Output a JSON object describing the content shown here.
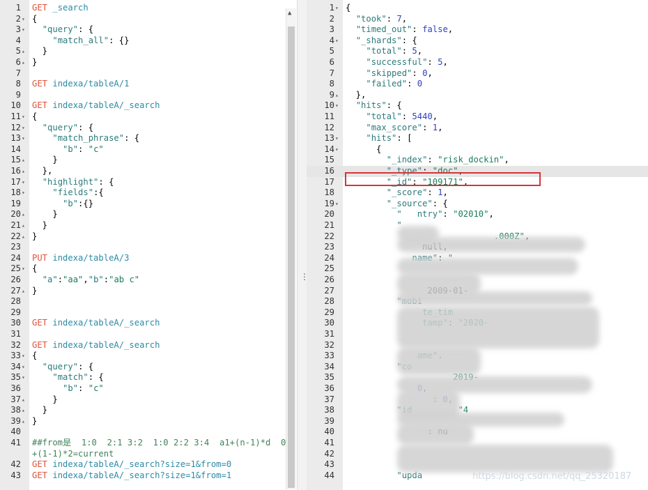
{
  "left_editor": {
    "lines": [
      {
        "n": "1",
        "fold": "",
        "html": "<span class='kw'>GET</span> <span class='url'>_search</span>"
      },
      {
        "n": "2",
        "fold": "▾",
        "html": "{"
      },
      {
        "n": "3",
        "fold": "▾",
        "html": "  <span class='k'>\"query\"</span>: {"
      },
      {
        "n": "4",
        "fold": "",
        "html": "    <span class='k'>\"match_all\"</span>: {}"
      },
      {
        "n": "5",
        "fold": "▴",
        "html": "  }"
      },
      {
        "n": "6",
        "fold": "▴",
        "html": "}"
      },
      {
        "n": "7",
        "fold": "",
        "html": ""
      },
      {
        "n": "8",
        "fold": "",
        "html": "<span class='kw'>GET</span> <span class='url'>indexa/tableA/1</span>"
      },
      {
        "n": "9",
        "fold": "",
        "html": ""
      },
      {
        "n": "10",
        "fold": "",
        "html": "<span class='kw'>GET</span> <span class='url'>indexa/tableA/_search</span>"
      },
      {
        "n": "11",
        "fold": "▾",
        "html": "{"
      },
      {
        "n": "12",
        "fold": "▾",
        "html": "  <span class='k'>\"query\"</span>: {"
      },
      {
        "n": "13",
        "fold": "▾",
        "html": "    <span class='k'>\"match_phrase\"</span>: {"
      },
      {
        "n": "14",
        "fold": "",
        "html": "      <span class='k'>\"b\"</span>: <span class='str'>\"c\"</span>"
      },
      {
        "n": "15",
        "fold": "▴",
        "html": "    }"
      },
      {
        "n": "16",
        "fold": "▴",
        "html": "  },"
      },
      {
        "n": "17",
        "fold": "▾",
        "html": "  <span class='k'>\"highlight\"</span>: {"
      },
      {
        "n": "18",
        "fold": "▾",
        "html": "    <span class='k'>\"fields\"</span>:{"
      },
      {
        "n": "19",
        "fold": "",
        "html": "      <span class='k'>\"b\"</span>:{}"
      },
      {
        "n": "20",
        "fold": "▴",
        "html": "    }"
      },
      {
        "n": "21",
        "fold": "▴",
        "html": "  }"
      },
      {
        "n": "22",
        "fold": "▴",
        "html": "}"
      },
      {
        "n": "23",
        "fold": "",
        "html": ""
      },
      {
        "n": "24",
        "fold": "",
        "html": "<span class='kw'>PUT</span> <span class='url'>indexa/tableA/3</span>"
      },
      {
        "n": "25",
        "fold": "▾",
        "html": "{"
      },
      {
        "n": "26",
        "fold": "",
        "html": "  <span class='k'>\"a\"</span>:<span class='str'>\"aa\"</span>,<span class='k'>\"b\"</span>:<span class='str'>\"ab c\"</span>"
      },
      {
        "n": "27",
        "fold": "▴",
        "html": "}"
      },
      {
        "n": "28",
        "fold": "",
        "html": ""
      },
      {
        "n": "29",
        "fold": "",
        "html": ""
      },
      {
        "n": "30",
        "fold": "",
        "html": "<span class='kw'>GET</span> <span class='url'>indexa/tableA/_search</span>"
      },
      {
        "n": "31",
        "fold": "",
        "html": ""
      },
      {
        "n": "32",
        "fold": "",
        "html": "<span class='kw'>GET</span> <span class='url'>indexa/tableA/_search</span>"
      },
      {
        "n": "33",
        "fold": "▾",
        "html": "{"
      },
      {
        "n": "34",
        "fold": "▾",
        "html": "  <span class='k'>\"query\"</span>: {"
      },
      {
        "n": "35",
        "fold": "▾",
        "html": "    <span class='k'>\"match\"</span>: {"
      },
      {
        "n": "36",
        "fold": "",
        "html": "      <span class='k'>\"b\"</span>: <span class='str'>\"c\"</span>"
      },
      {
        "n": "37",
        "fold": "▴",
        "html": "    }"
      },
      {
        "n": "38",
        "fold": "▴",
        "html": "  }"
      },
      {
        "n": "39",
        "fold": "▴",
        "html": "}"
      },
      {
        "n": "40",
        "fold": "",
        "html": ""
      },
      {
        "n": "41",
        "fold": "",
        "html": "<span class='cmt'>##from是  1:0  2:1 3:2  1:0 2:2 3:4  a1+(n-1)*d  0</span>"
      },
      {
        "n": "",
        "fold": "",
        "html": "<span class='cmt'>+(1-1)*2=current</span>"
      },
      {
        "n": "42",
        "fold": "",
        "html": "<span class='kw'>GET</span> <span class='url'>indexa/tableA/_search?size=1&amp;from=0</span>"
      },
      {
        "n": "43",
        "fold": "",
        "html": "<span class='kw'>GET</span> <span class='url'>indexa/tableA/_search?size=1&amp;from=1</span>"
      }
    ]
  },
  "right_editor": {
    "highlighted_line": "16",
    "lines": [
      {
        "n": "1",
        "fold": "▾",
        "html": "{"
      },
      {
        "n": "2",
        "fold": "",
        "html": "  <span class='k'>\"took\"</span>: <span class='num'>7</span>,"
      },
      {
        "n": "3",
        "fold": "",
        "html": "  <span class='k'>\"timed_out\"</span>: <span class='bool'>false</span>,"
      },
      {
        "n": "4",
        "fold": "▾",
        "html": "  <span class='k'>\"_shards\"</span>: {"
      },
      {
        "n": "5",
        "fold": "",
        "html": "    <span class='k'>\"total\"</span>: <span class='num'>5</span>,"
      },
      {
        "n": "6",
        "fold": "",
        "html": "    <span class='k'>\"successful\"</span>: <span class='num'>5</span>,"
      },
      {
        "n": "7",
        "fold": "",
        "html": "    <span class='k'>\"skipped\"</span>: <span class='num'>0</span>,"
      },
      {
        "n": "8",
        "fold": "",
        "html": "    <span class='k'>\"failed\"</span>: <span class='num'>0</span>"
      },
      {
        "n": "9",
        "fold": "▴",
        "html": "  },"
      },
      {
        "n": "10",
        "fold": "▾",
        "html": "  <span class='k'>\"hits\"</span>: {"
      },
      {
        "n": "11",
        "fold": "",
        "html": "    <span class='k'>\"total\"</span>: <span class='num'>5440</span>,"
      },
      {
        "n": "12",
        "fold": "",
        "html": "    <span class='k'>\"max_score\"</span>: <span class='num'>1</span>,"
      },
      {
        "n": "13",
        "fold": "▾",
        "html": "    <span class='k'>\"hits\"</span>: ["
      },
      {
        "n": "14",
        "fold": "▾",
        "html": "      {"
      },
      {
        "n": "15",
        "fold": "",
        "html": "        <span class='k'>\"_index\"</span>: <span class='str'>\"risk_dockin\"</span>,"
      },
      {
        "n": "16",
        "fold": "",
        "html": "        <span class='k'>\"_type\"</span>: <span class='str'>\"doc\"</span>,"
      },
      {
        "n": "17",
        "fold": "",
        "html": "        <span class='k'>\"_id\"</span>: <span class='str'>\"109171\"</span>,"
      },
      {
        "n": "18",
        "fold": "",
        "html": "        <span class='k'>\"_score\"</span>: <span class='num'>1</span>,"
      },
      {
        "n": "19",
        "fold": "▾",
        "html": "        <span class='k'>\"_source\"</span>: {"
      },
      {
        "n": "20",
        "fold": "",
        "html": "          <span class='k'>\"   ntry\"</span>: <span class='str'>\"02010\"</span>,"
      },
      {
        "n": "21",
        "fold": "",
        "html": "          <span class='k'>\"</span>"
      },
      {
        "n": "22",
        "fold": "",
        "html": "                             <span class='str'>.000Z\"</span>,"
      },
      {
        "n": "23",
        "fold": "",
        "html": "               null,"
      },
      {
        "n": "24",
        "fold": "",
        "html": "             <span class='k'>name\"</span>: <span class='str'>\"</span>"
      },
      {
        "n": "25",
        "fold": "",
        "html": ""
      },
      {
        "n": "26",
        "fold": "",
        "html": ""
      },
      {
        "n": "27",
        "fold": "",
        "html": "                2009-01-"
      },
      {
        "n": "28",
        "fold": "",
        "html": "          <span class='k'>\"mobi</span>"
      },
      {
        "n": "29",
        "fold": "",
        "html": "               <span class='k'>te_tim</span>"
      },
      {
        "n": "30",
        "fold": "",
        "html": "               <span class='k'>tamp\"</span>: <span class='str'>\"2020-</span>"
      },
      {
        "n": "31",
        "fold": "",
        "html": ""
      },
      {
        "n": "32",
        "fold": "",
        "html": ""
      },
      {
        "n": "33",
        "fold": "",
        "html": "              <span class='k'>ame\"</span>."
      },
      {
        "n": "34",
        "fold": "",
        "html": "          <span class='k'>\"co</span>"
      },
      {
        "n": "35",
        "fold": "",
        "html": "                     <span class='str'>2019-</span>"
      },
      {
        "n": "36",
        "fold": "",
        "html": "              <span class='num'>0</span>,"
      },
      {
        "n": "37",
        "fold": "",
        "html": "                 : <span class='num'>0</span>,"
      },
      {
        "n": "38",
        "fold": "",
        "html": "          <span class='k'>\"id</span>         <span class='str'>\"4</span>"
      },
      {
        "n": "39",
        "fold": "",
        "html": ""
      },
      {
        "n": "40",
        "fold": "",
        "html": "                : nu"
      },
      {
        "n": "41",
        "fold": "",
        "html": ""
      },
      {
        "n": "42",
        "fold": "",
        "html": ""
      },
      {
        "n": "43",
        "fold": "",
        "html": ""
      },
      {
        "n": "44",
        "fold": "",
        "html": "          <span class='k'>\"upda</span>"
      }
    ]
  },
  "divider": {
    "grip": "⋮"
  },
  "watermark": "https://blog.csdn.net/qq_25320187"
}
